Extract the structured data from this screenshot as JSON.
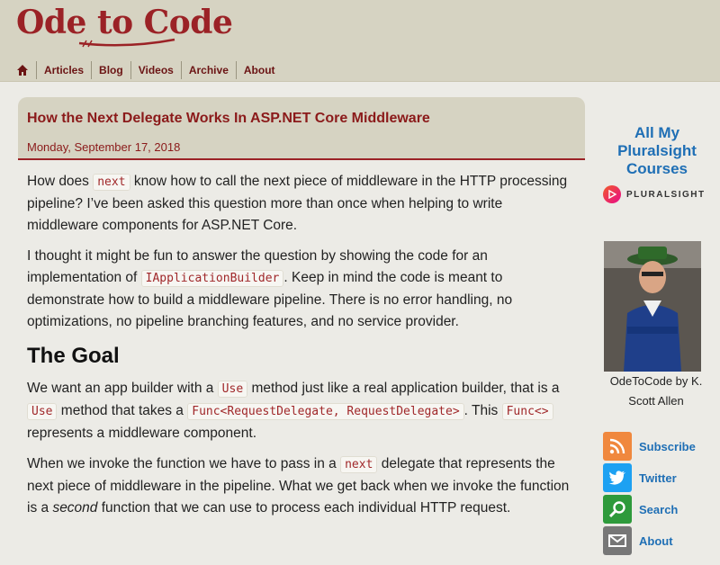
{
  "site": {
    "logo_text": "Ode to Code"
  },
  "nav": {
    "items": [
      {
        "label": "Articles"
      },
      {
        "label": "Blog"
      },
      {
        "label": "Videos"
      },
      {
        "label": "Archive"
      },
      {
        "label": "About"
      }
    ]
  },
  "article": {
    "title": "How the Next Delegate Works In ASP.NET Core Middleware",
    "date": "Monday, September 17, 2018",
    "p1": {
      "a": "How does ",
      "code": "next",
      "b": " know how to call the next piece of middleware in the HTTP processing pipeline? I’ve been asked this question more than once when helping to write middleware components for ASP.NET Core."
    },
    "p2": {
      "a": "I thought it might be fun to answer the question by showing the code for an implementation of ",
      "code": "IApplicationBuilder",
      "b": ". Keep in mind the code is meant to demonstrate how to build a middleware pipeline. There is no error handling, no optimizations, no pipeline branching features, and no service provider."
    },
    "heading": "The Goal",
    "p3": {
      "a": "We want an app builder with a ",
      "code1": "Use",
      "b": " method just like a real application builder, that is a ",
      "code2": "Use",
      "c": " method that takes a ",
      "code3": "Func<RequestDelegate, RequestDelegate>",
      "d": ". This ",
      "code4": "Func<>",
      "e": " represents a middleware component."
    },
    "p4": {
      "a": "When we invoke the function we have to pass in a ",
      "code": "next",
      "b": " delegate that represents the next piece of middleware in the pipeline. What we get back when we invoke the function is a ",
      "em": "second",
      "c": " function that we can use to process each individual HTTP request."
    }
  },
  "sidebar": {
    "pluralsight": {
      "line1": "All My",
      "line2": "Pluralsight",
      "line3": "Courses",
      "brand": "PLURALSIGHT"
    },
    "caption": "OdeToCode by K. Scott Allen",
    "social": [
      {
        "label": "Subscribe",
        "icon": "rss-icon",
        "color": "#f0883e"
      },
      {
        "label": "Twitter",
        "icon": "twitter-icon",
        "color": "#1da1f2"
      },
      {
        "label": "Search",
        "icon": "search-icon",
        "color": "#2e9a3b"
      },
      {
        "label": "About",
        "icon": "mail-icon",
        "color": "#777777"
      }
    ]
  },
  "colors": {
    "brand": "#9b2226",
    "link": "#1f6fb5",
    "header_bg": "#d6d3c2",
    "page_bg": "#ecebe6"
  }
}
